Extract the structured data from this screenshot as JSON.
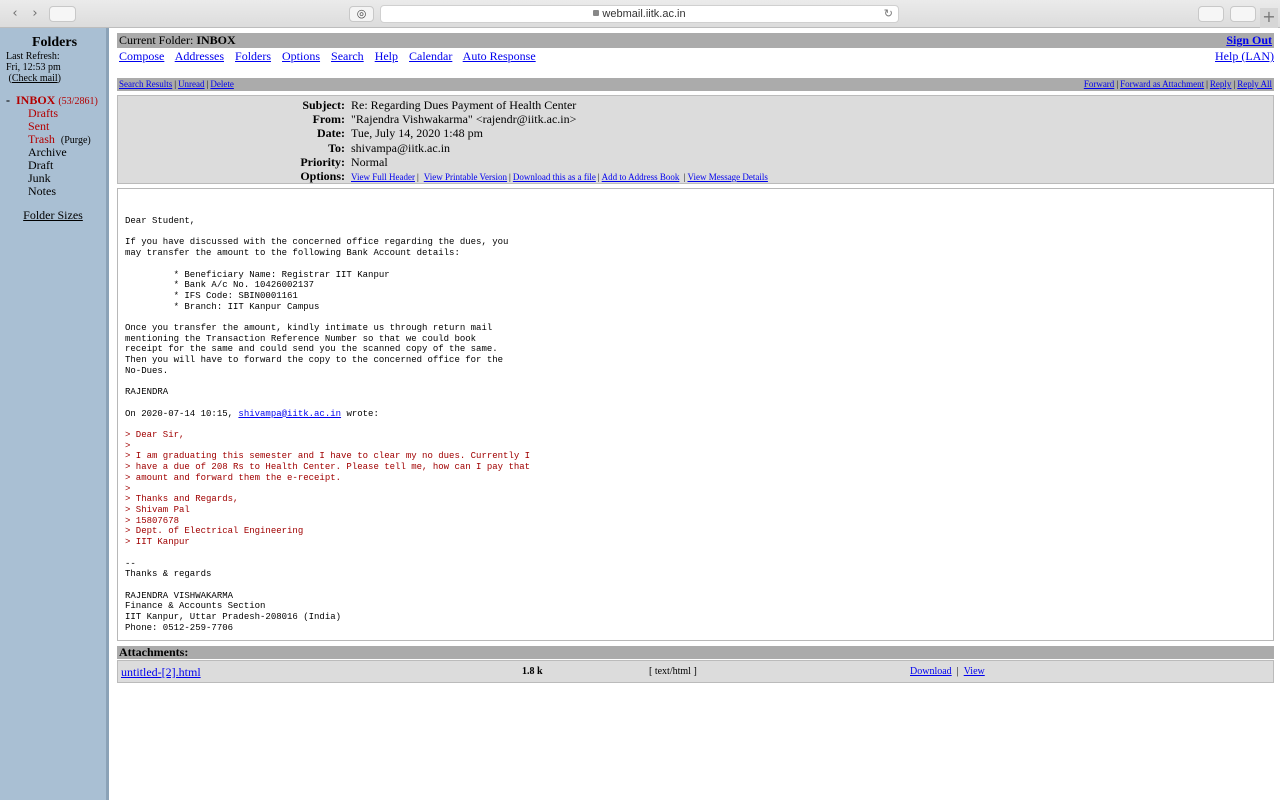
{
  "browser": {
    "url": "webmail.iitk.ac.in"
  },
  "sidebar": {
    "title": "Folders",
    "last_refresh_label": "Last Refresh:",
    "last_refresh_time": "Fri, 12:53 pm",
    "check_mail": "Check mail",
    "inbox_label": "INBOX",
    "inbox_count": "(53/2861)",
    "folders": [
      "Drafts",
      "Sent",
      "Trash",
      "Archive",
      "Draft",
      "Junk",
      "Notes"
    ],
    "purge_label": "(Purge)",
    "folder_sizes": "Folder Sizes"
  },
  "top": {
    "current_folder_label": "Current Folder:",
    "current_folder": "INBOX",
    "sign_out": "Sign Out",
    "menu": [
      "Compose",
      "Addresses",
      "Folders",
      "Options",
      "Search",
      "Help",
      "Calendar",
      "Auto Response"
    ],
    "help_lan": "Help (LAN)"
  },
  "actions": {
    "left": [
      "Search Results",
      "Unread",
      "Delete"
    ],
    "right": [
      "Forward",
      "Forward as Attachment",
      "Reply",
      "Reply All"
    ]
  },
  "message": {
    "labels": {
      "subject": "Subject:",
      "from": "From:",
      "date": "Date:",
      "to": "To:",
      "priority": "Priority:",
      "options": "Options:"
    },
    "subject": "Re: Regarding Dues Payment of Health Center",
    "from": "\"Rajendra Vishwakarma\" <rajendr@iitk.ac.in>",
    "date": "Tue, July 14, 2020 1:48 pm",
    "to": "shivampa@iitk.ac.in",
    "priority": "Normal",
    "options": [
      "View Full Header",
      "View Printable Version",
      "Download this as a file",
      "Add to Address Book",
      "View Message Details"
    ]
  },
  "body": {
    "part1": "Dear Student,\n\nIf you have discussed with the concerned office regarding the dues, you\nmay transfer the amount to the following Bank Account details:\n\n         * Beneficiary Name: Registrar IIT Kanpur\n         * Bank A/c No. 10426002137\n         * IFS Code: SBIN0001161\n         * Branch: IIT Kanpur Campus\n\nOnce you transfer the amount, kindly intimate us through return mail\nmentioning the Transaction Reference Number so that we could book\nreceipt for the same and could send you the scanned copy of the same.\nThen you will have to forward the copy to the concerned office for the\nNo-Dues.\n\nRAJENDRA\n\nOn 2020-07-14 10:15, ",
    "quote_email": "shivampa@iitk.ac.in",
    "wrote": " wrote:\n\n",
    "quoted": "> Dear Sir,\n>\n> I am graduating this semester and I have to clear my no dues. Currently I\n> have a due of 208 Rs to Health Center. Please tell me, how can I pay that\n> amount and forward them the e-receipt.\n>\n> Thanks and Regards,\n> Shivam Pal\n> 15807678\n> Dept. of Electrical Engineering\n> IIT Kanpur",
    "signature": "\n\n--\nThanks & regards\n\nRAJENDRA VISHWAKARMA\nFinance & Accounts Section\nIIT Kanpur, Uttar Pradesh-208016 (India)\nPhone: 0512-259-7706"
  },
  "attachments": {
    "title": "Attachments:",
    "items": [
      {
        "name": "untitled-[2].html",
        "size": "1.8 k",
        "type": "[ text/html ]",
        "download": "Download",
        "view": "View"
      }
    ]
  }
}
